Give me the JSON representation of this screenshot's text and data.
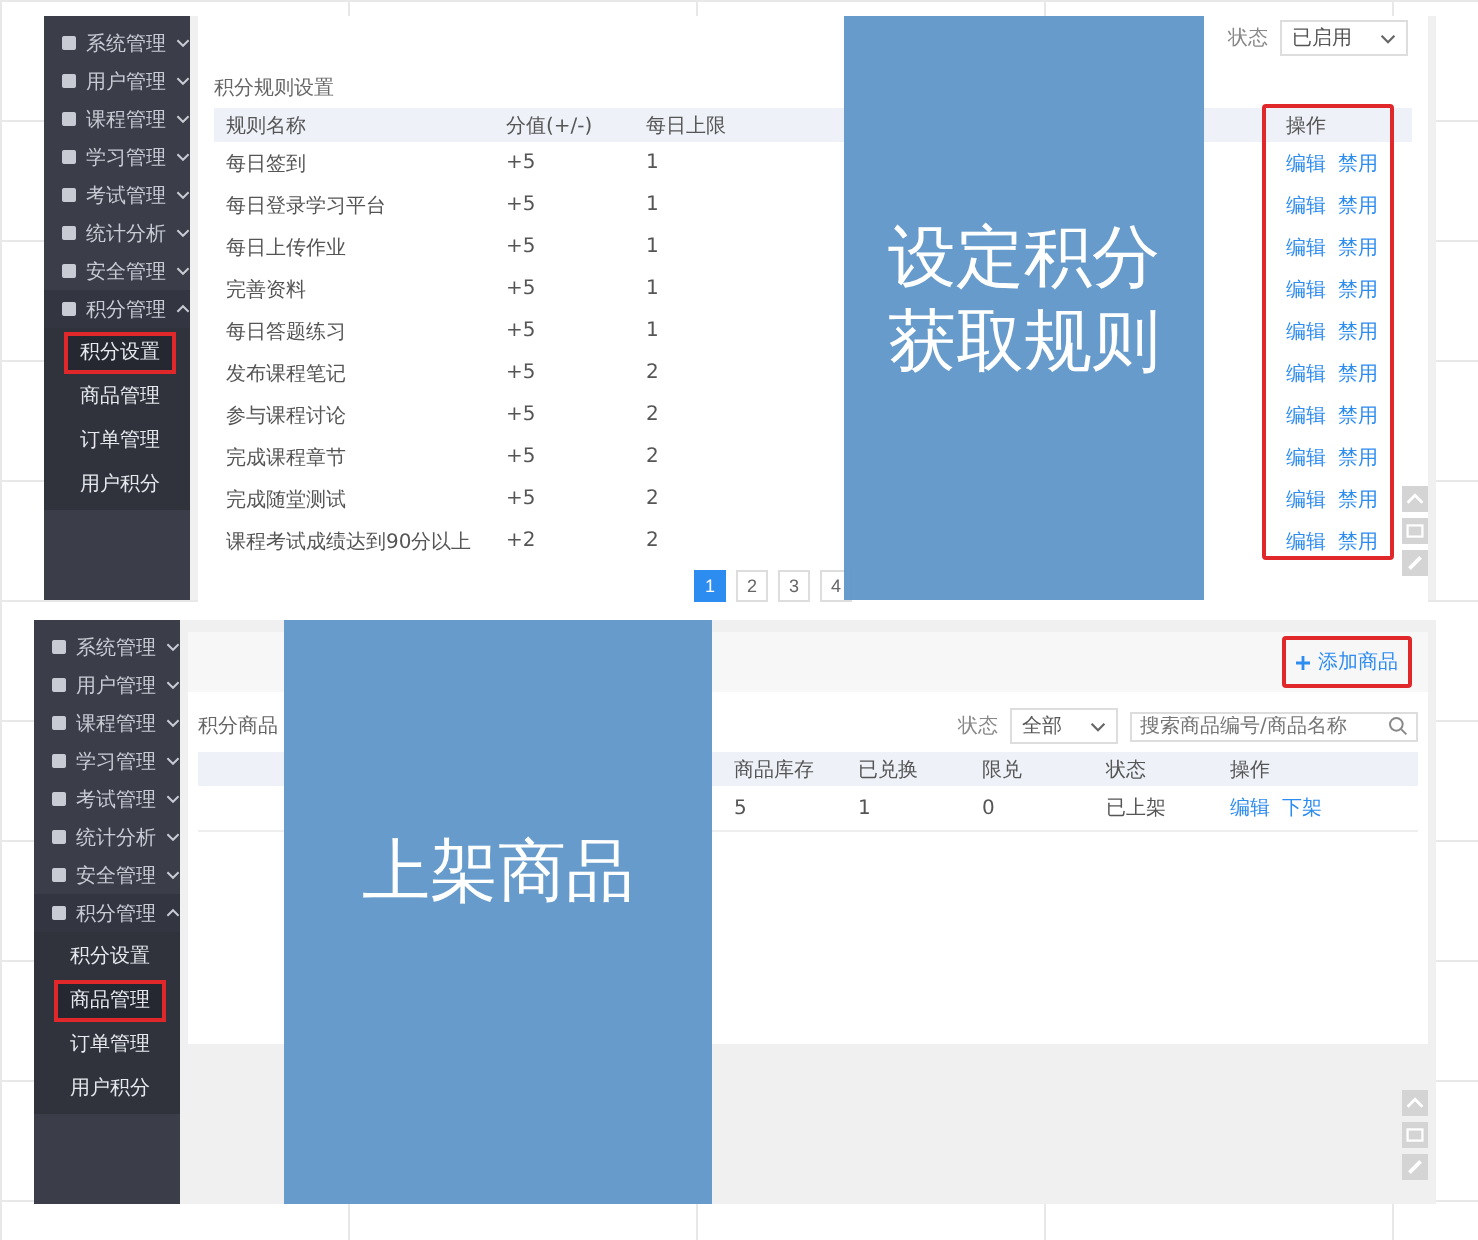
{
  "panels": [
    {
      "sidebar": {
        "items": [
          {
            "label": "系统管理",
            "expanded": false
          },
          {
            "label": "用户管理",
            "expanded": false
          },
          {
            "label": "课程管理",
            "expanded": false
          },
          {
            "label": "学习管理",
            "expanded": false
          },
          {
            "label": "考试管理",
            "expanded": false
          },
          {
            "label": "统计分析",
            "expanded": false
          },
          {
            "label": "安全管理",
            "expanded": false
          },
          {
            "label": "积分管理",
            "expanded": true,
            "children": [
              {
                "label": "积分设置",
                "selected": true
              },
              {
                "label": "商品管理",
                "selected": false
              },
              {
                "label": "订单管理",
                "selected": false
              },
              {
                "label": "用户积分",
                "selected": false
              }
            ]
          }
        ]
      },
      "kind": "rules",
      "filter": {
        "label": "状态",
        "value": "已启用"
      },
      "card_title": "积分规则设置",
      "table": {
        "columns": [
          "规则名称",
          "分值(+/-)",
          "每日上限",
          "操作"
        ],
        "rows": [
          {
            "name": "每日签到",
            "score": "+5",
            "limit": "1",
            "actions": [
              "编辑",
              "禁用"
            ]
          },
          {
            "name": "每日登录学习平台",
            "score": "+5",
            "limit": "1",
            "actions": [
              "编辑",
              "禁用"
            ]
          },
          {
            "name": "每日上传作业",
            "score": "+5",
            "limit": "1",
            "actions": [
              "编辑",
              "禁用"
            ]
          },
          {
            "name": "完善资料",
            "score": "+5",
            "limit": "1",
            "actions": [
              "编辑",
              "禁用"
            ]
          },
          {
            "name": "每日答题练习",
            "score": "+5",
            "limit": "1",
            "actions": [
              "编辑",
              "禁用"
            ]
          },
          {
            "name": "发布课程笔记",
            "score": "+5",
            "limit": "2",
            "actions": [
              "编辑",
              "禁用"
            ]
          },
          {
            "name": "参与课程讨论",
            "score": "+5",
            "limit": "2",
            "actions": [
              "编辑",
              "禁用"
            ]
          },
          {
            "name": "完成课程章节",
            "score": "+5",
            "limit": "2",
            "actions": [
              "编辑",
              "禁用"
            ]
          },
          {
            "name": "完成随堂测试",
            "score": "+5",
            "limit": "2",
            "actions": [
              "编辑",
              "禁用"
            ]
          },
          {
            "name": "课程考试成绩达到90分以上",
            "score": "+2",
            "limit": "2",
            "actions": [
              "编辑",
              "禁用"
            ]
          }
        ]
      },
      "pagination": [
        {
          "label": "1",
          "selected": true
        },
        {
          "label": "2",
          "selected": false
        },
        {
          "label": "3",
          "selected": false
        },
        {
          "label": "4",
          "selected": false
        }
      ],
      "overlay_lines": [
        "设定积分",
        "获取规则"
      ]
    },
    {
      "sidebar": {
        "items": [
          {
            "label": "系统管理",
            "expanded": false
          },
          {
            "label": "用户管理",
            "expanded": false
          },
          {
            "label": "课程管理",
            "expanded": false
          },
          {
            "label": "学习管理",
            "expanded": false
          },
          {
            "label": "考试管理",
            "expanded": false
          },
          {
            "label": "统计分析",
            "expanded": false
          },
          {
            "label": "安全管理",
            "expanded": false
          },
          {
            "label": "积分管理",
            "expanded": true,
            "children": [
              {
                "label": "积分设置",
                "selected": false
              },
              {
                "label": "商品管理",
                "selected": true
              },
              {
                "label": "订单管理",
                "selected": false
              },
              {
                "label": "用户积分",
                "selected": false
              }
            ]
          }
        ]
      },
      "kind": "goods",
      "add_button": "添加商品",
      "card_title": "积分商品",
      "filter": {
        "label": "状态",
        "value": "全部"
      },
      "search": {
        "placeholder": "搜索商品编号/商品名称"
      },
      "table": {
        "columns": [
          "商品库存",
          "已兑换",
          "限兑",
          "状态",
          "操作"
        ],
        "rows": [
          {
            "stock": "5",
            "exchanged": "1",
            "limit": "0",
            "status": "已上架",
            "actions": [
              "编辑",
              "下架"
            ]
          }
        ]
      },
      "overlay_lines": [
        "上架商品"
      ]
    }
  ]
}
